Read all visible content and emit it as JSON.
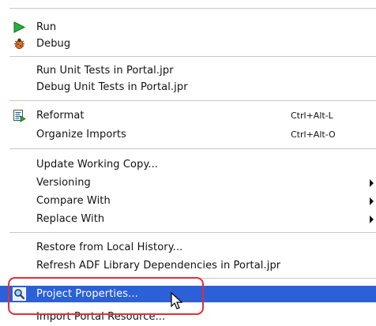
{
  "menu": {
    "items": [
      {
        "label": "Run",
        "icon": "run-icon"
      },
      {
        "label": "Debug",
        "icon": "bug-icon"
      },
      {
        "label": "Run Unit Tests in Portal.jpr"
      },
      {
        "label": "Debug Unit Tests in Portal.jpr"
      },
      {
        "label": "Reformat",
        "shortcut": "Ctrl+Alt-L",
        "icon": "reformat-icon"
      },
      {
        "label": "Organize Imports",
        "shortcut": "Ctrl+Alt-O"
      },
      {
        "label": "Update Working Copy..."
      },
      {
        "label": "Versioning",
        "submenu": true
      },
      {
        "label": "Compare With",
        "submenu": true
      },
      {
        "label": "Replace With",
        "submenu": true
      },
      {
        "label": "Restore from Local History..."
      },
      {
        "label": "Refresh ADF Library Dependencies in Portal.jpr"
      },
      {
        "label": "Project Properties...",
        "icon": "magnifier-icon",
        "selected": true
      },
      {
        "label": "Import Portal Resource..."
      }
    ]
  },
  "colors": {
    "selection": "#2b60d6",
    "callout": "#e32d37",
    "separator": "#c8c8c8"
  }
}
